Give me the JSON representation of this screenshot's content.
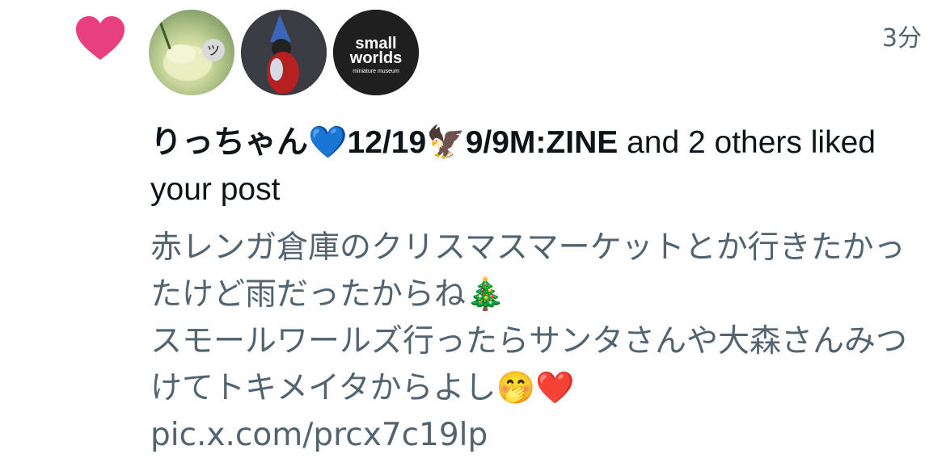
{
  "notification": {
    "timestamp": "3分",
    "liker_name": "りっちゃん💙12/19🦅9/9M:ZINE",
    "headline_suffix": " and 2 others liked your post",
    "avatars": [
      {
        "name": "user-avatar-1",
        "badge": "😃"
      },
      {
        "name": "user-avatar-2"
      },
      {
        "name": "user-avatar-3",
        "logo_line1": "small",
        "logo_line2": "worlds",
        "logo_line3": "miniature museum"
      }
    ],
    "post_text": "赤レンガ倉庫のクリスマスマーケットとか行きたかったけど雨だったからね🎄\nスモールワールズ行ったらサンタさんや大森さんみつけてトキメイタからよし🤭❤️ ",
    "post_link": "pic.x.com/prcx7c19lp"
  },
  "colors": {
    "heart": "#e8407e",
    "secondary_text": "#536471",
    "primary_text": "#0f1419"
  },
  "icons": {
    "like": "heart-icon"
  }
}
